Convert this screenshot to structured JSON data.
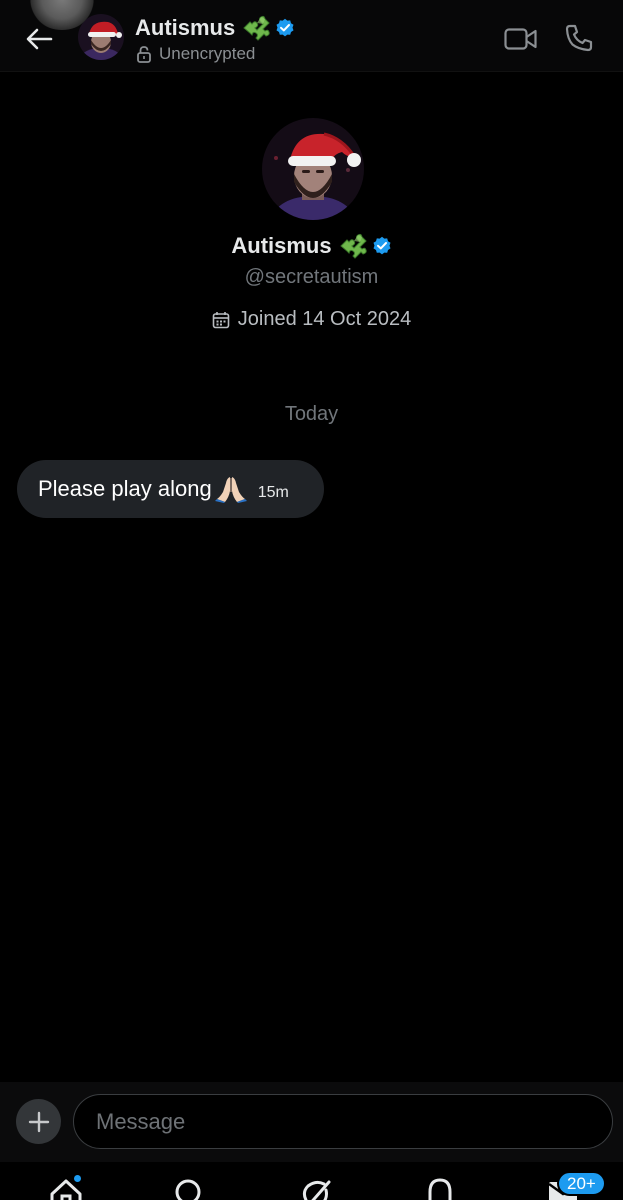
{
  "header": {
    "name": "Autismus",
    "subtitle": "Unencrypted",
    "icons": [
      "back-arrow-icon",
      "puzzle-icon",
      "verified-icon",
      "lock-icon",
      "video-call-icon",
      "phone-icon"
    ]
  },
  "profile": {
    "name": "Autismus",
    "handle": "@secretautism",
    "joined": "Joined 14 Oct 2024"
  },
  "conversation": {
    "day_separator": "Today",
    "messages": [
      {
        "text": "Please play along",
        "emoji": "🙏🏻",
        "time": "15m"
      }
    ]
  },
  "composer": {
    "placeholder": "Message"
  },
  "bottom_nav": {
    "items": [
      "home",
      "search",
      "grok",
      "notifications",
      "messages"
    ],
    "messages_badge": "20+"
  },
  "colors": {
    "background": "#000000",
    "bubble": "#202327",
    "accent": "#1d9bf0",
    "muted": "#71767b"
  }
}
